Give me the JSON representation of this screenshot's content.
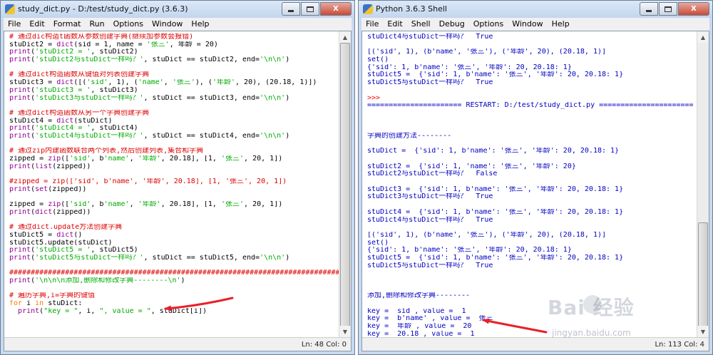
{
  "editor": {
    "title": "study_dict.py - D:/test/study_dict.py (3.6.3)",
    "menu": [
      "File",
      "Edit",
      "Format",
      "Run",
      "Options",
      "Window",
      "Help"
    ],
    "status": "Ln: 48  Col: 0",
    "code_lines": [
      [
        {
          "t": "c",
          "v": "# 通过dic构造t函数从参数创建字典(继续加参数会报错)"
        }
      ],
      [
        {
          "t": "p",
          "v": "stuDict2 = "
        },
        {
          "t": "b",
          "v": "dict"
        },
        {
          "t": "p",
          "v": "(sid = 1, name = "
        },
        {
          "t": "s",
          "v": "'张三'"
        },
        {
          "t": "p",
          "v": ", 年龄 = 20)"
        }
      ],
      [
        {
          "t": "b",
          "v": "print"
        },
        {
          "t": "p",
          "v": "("
        },
        {
          "t": "s",
          "v": "'stuDict2 = '"
        },
        {
          "t": "p",
          "v": ", stuDict2)"
        }
      ],
      [
        {
          "t": "b",
          "v": "print"
        },
        {
          "t": "p",
          "v": "("
        },
        {
          "t": "s",
          "v": "'stuDict2与stuDict一样吗？'"
        },
        {
          "t": "p",
          "v": ", stuDict == stuDict2, end="
        },
        {
          "t": "s",
          "v": "'\\n\\n'"
        },
        {
          "t": "p",
          "v": ")"
        }
      ],
      [
        {
          "t": "p",
          "v": ""
        }
      ],
      [
        {
          "t": "c",
          "v": "# 通过dict构造函数从键值对列表创建字典"
        }
      ],
      [
        {
          "t": "p",
          "v": "stuDict3 = "
        },
        {
          "t": "b",
          "v": "dict"
        },
        {
          "t": "p",
          "v": "([("
        },
        {
          "t": "s",
          "v": "'sid'"
        },
        {
          "t": "p",
          "v": ", 1), ("
        },
        {
          "t": "s",
          "v": "'name'"
        },
        {
          "t": "p",
          "v": ", "
        },
        {
          "t": "s",
          "v": "'张三'"
        },
        {
          "t": "p",
          "v": "), ("
        },
        {
          "t": "s",
          "v": "'年龄'"
        },
        {
          "t": "p",
          "v": ", 20), (20.18, 1)])"
        }
      ],
      [
        {
          "t": "b",
          "v": "print"
        },
        {
          "t": "p",
          "v": "("
        },
        {
          "t": "s",
          "v": "'stuDict3 = '"
        },
        {
          "t": "p",
          "v": ", stuDict3)"
        }
      ],
      [
        {
          "t": "b",
          "v": "print"
        },
        {
          "t": "p",
          "v": "("
        },
        {
          "t": "s",
          "v": "'stuDict3与stuDict一样吗？'"
        },
        {
          "t": "p",
          "v": ", stuDict == stuDict3, end="
        },
        {
          "t": "s",
          "v": "'\\n\\n'"
        },
        {
          "t": "p",
          "v": ")"
        }
      ],
      [
        {
          "t": "p",
          "v": ""
        }
      ],
      [
        {
          "t": "c",
          "v": "# 通过dict构造函数从另一个字典创建字典"
        }
      ],
      [
        {
          "t": "p",
          "v": "stuDict4 = "
        },
        {
          "t": "b",
          "v": "dict"
        },
        {
          "t": "p",
          "v": "(stuDict)"
        }
      ],
      [
        {
          "t": "b",
          "v": "print"
        },
        {
          "t": "p",
          "v": "("
        },
        {
          "t": "s",
          "v": "'stuDict4 = '"
        },
        {
          "t": "p",
          "v": ", stuDict4)"
        }
      ],
      [
        {
          "t": "b",
          "v": "print"
        },
        {
          "t": "p",
          "v": "("
        },
        {
          "t": "s",
          "v": "'stuDict4与stuDict一样吗？'"
        },
        {
          "t": "p",
          "v": ", stuDict == stuDict4, end="
        },
        {
          "t": "s",
          "v": "'\\n\\n'"
        },
        {
          "t": "p",
          "v": ")"
        }
      ],
      [
        {
          "t": "p",
          "v": ""
        }
      ],
      [
        {
          "t": "c",
          "v": "# 通过zip内建函数联合两个列表,然后创建列表,集合和字典"
        }
      ],
      [
        {
          "t": "p",
          "v": "zipped = "
        },
        {
          "t": "b",
          "v": "zip"
        },
        {
          "t": "p",
          "v": "(["
        },
        {
          "t": "s",
          "v": "'sid'"
        },
        {
          "t": "p",
          "v": ", b"
        },
        {
          "t": "s",
          "v": "'name'"
        },
        {
          "t": "p",
          "v": ", "
        },
        {
          "t": "s",
          "v": "'年龄'"
        },
        {
          "t": "p",
          "v": ", 20.18], [1, "
        },
        {
          "t": "s",
          "v": "'张三'"
        },
        {
          "t": "p",
          "v": ", 20, 1])"
        }
      ],
      [
        {
          "t": "b",
          "v": "print"
        },
        {
          "t": "p",
          "v": "("
        },
        {
          "t": "b",
          "v": "list"
        },
        {
          "t": "p",
          "v": "(zipped))"
        }
      ],
      [
        {
          "t": "p",
          "v": ""
        }
      ],
      [
        {
          "t": "c",
          "v": "#zipped = zip(['sid', b'name', '年龄', 20.18], [1, '张三', 20, 1])"
        }
      ],
      [
        {
          "t": "b",
          "v": "print"
        },
        {
          "t": "p",
          "v": "("
        },
        {
          "t": "b",
          "v": "set"
        },
        {
          "t": "p",
          "v": "(zipped))"
        }
      ],
      [
        {
          "t": "p",
          "v": ""
        }
      ],
      [
        {
          "t": "p",
          "v": "zipped = "
        },
        {
          "t": "b",
          "v": "zip"
        },
        {
          "t": "p",
          "v": "(["
        },
        {
          "t": "s",
          "v": "'sid'"
        },
        {
          "t": "p",
          "v": ", b"
        },
        {
          "t": "s",
          "v": "'name'"
        },
        {
          "t": "p",
          "v": ", "
        },
        {
          "t": "s",
          "v": "'年龄'"
        },
        {
          "t": "p",
          "v": ", 20.18], [1, "
        },
        {
          "t": "s",
          "v": "'张三'"
        },
        {
          "t": "p",
          "v": ", 20, 1])"
        }
      ],
      [
        {
          "t": "b",
          "v": "print"
        },
        {
          "t": "p",
          "v": "("
        },
        {
          "t": "b",
          "v": "dict"
        },
        {
          "t": "p",
          "v": "(zipped))"
        }
      ],
      [
        {
          "t": "p",
          "v": ""
        }
      ],
      [
        {
          "t": "c",
          "v": "# 通过dict.update方法创建字典"
        }
      ],
      [
        {
          "t": "p",
          "v": "stuDict5 = "
        },
        {
          "t": "b",
          "v": "dict"
        },
        {
          "t": "p",
          "v": "()"
        }
      ],
      [
        {
          "t": "p",
          "v": "stuDict5.update(stuDict)"
        }
      ],
      [
        {
          "t": "b",
          "v": "print"
        },
        {
          "t": "p",
          "v": "("
        },
        {
          "t": "s",
          "v": "'stuDict5 = '"
        },
        {
          "t": "p",
          "v": ", stuDict5)"
        }
      ],
      [
        {
          "t": "b",
          "v": "print"
        },
        {
          "t": "p",
          "v": "("
        },
        {
          "t": "s",
          "v": "'stuDict5与stuDict一样吗？'"
        },
        {
          "t": "p",
          "v": ", stuDict == stuDict5, end="
        },
        {
          "t": "s",
          "v": "'\\n\\n'"
        },
        {
          "t": "p",
          "v": ")"
        }
      ],
      [
        {
          "t": "p",
          "v": ""
        }
      ],
      [
        {
          "t": "c",
          "v": "################################################################################"
        }
      ],
      [
        {
          "t": "b",
          "v": "print"
        },
        {
          "t": "p",
          "v": "("
        },
        {
          "t": "s",
          "v": "'\\n\\n\\n添加,删除和修改字典--------\\n'"
        },
        {
          "t": "p",
          "v": ")"
        }
      ],
      [
        {
          "t": "p",
          "v": ""
        }
      ],
      [
        {
          "t": "c",
          "v": "# 遍历字典,i=字典的键值"
        }
      ],
      [
        {
          "t": "k",
          "v": "for"
        },
        {
          "t": "p",
          "v": " i "
        },
        {
          "t": "k",
          "v": "in"
        },
        {
          "t": "p",
          "v": " stuDict:"
        }
      ],
      [
        {
          "t": "p",
          "v": "  "
        },
        {
          "t": "b",
          "v": "print"
        },
        {
          "t": "p",
          "v": "("
        },
        {
          "t": "s",
          "v": "\"key = \""
        },
        {
          "t": "p",
          "v": ", i, "
        },
        {
          "t": "s",
          "v": "\", value = \""
        },
        {
          "t": "p",
          "v": ", stuDict[i])"
        }
      ]
    ]
  },
  "shell": {
    "title": "Python 3.6.3 Shell",
    "menu": [
      "File",
      "Edit",
      "Shell",
      "Debug",
      "Options",
      "Window",
      "Help"
    ],
    "status": "Ln: 113  Col: 4",
    "output_lines": [
      {
        "t": "o",
        "v": "stuDict4与stuDict一样吗？  True"
      },
      {
        "t": "o",
        "v": ""
      },
      {
        "t": "o",
        "v": "[('sid', 1), (b'name', '张三'), ('年龄', 20), (20.18, 1)]"
      },
      {
        "t": "o",
        "v": "set()"
      },
      {
        "t": "o",
        "v": "{'sid': 1, b'name': '张三', '年龄': 20, 20.18: 1}"
      },
      {
        "t": "o",
        "v": "stuDict5 =  {'sid': 1, b'name': '张三', '年龄': 20, 20.18: 1}"
      },
      {
        "t": "o",
        "v": "stuDict5与stuDict一样吗？  True"
      },
      {
        "t": "o",
        "v": ""
      },
      {
        "t": "r",
        "v": ">>>"
      },
      {
        "t": "o",
        "v": "====================== RESTART: D:/test/study_dict.py ======================"
      },
      {
        "t": "o",
        "v": ""
      },
      {
        "t": "o",
        "v": ""
      },
      {
        "t": "o",
        "v": ""
      },
      {
        "t": "o",
        "v": "字典的创建方法--------"
      },
      {
        "t": "o",
        "v": ""
      },
      {
        "t": "o",
        "v": "stuDict =  {'sid': 1, b'name': '张三', '年龄': 20, 20.18: 1}"
      },
      {
        "t": "o",
        "v": ""
      },
      {
        "t": "o",
        "v": "stuDict2 =  {'sid': 1, 'name': '张三', '年龄': 20}"
      },
      {
        "t": "o",
        "v": "stuDict2与stuDict一样吗？  False"
      },
      {
        "t": "o",
        "v": ""
      },
      {
        "t": "o",
        "v": "stuDict3 =  {'sid': 1, b'name': '张三', '年龄': 20, 20.18: 1}"
      },
      {
        "t": "o",
        "v": "stuDict3与stuDict一样吗？  True"
      },
      {
        "t": "o",
        "v": ""
      },
      {
        "t": "o",
        "v": "stuDict4 =  {'sid': 1, b'name': '张三', '年龄': 20, 20.18: 1}"
      },
      {
        "t": "o",
        "v": "stuDict4与stuDict一样吗？  True"
      },
      {
        "t": "o",
        "v": ""
      },
      {
        "t": "o",
        "v": "[('sid', 1), (b'name', '张三'), ('年龄', 20), (20.18, 1)]"
      },
      {
        "t": "o",
        "v": "set()"
      },
      {
        "t": "o",
        "v": "{'sid': 1, b'name': '张三', '年龄': 20, 20.18: 1}"
      },
      {
        "t": "o",
        "v": "stuDict5 =  {'sid': 1, b'name': '张三', '年龄': 20, 20.18: 1}"
      },
      {
        "t": "o",
        "v": "stuDict5与stuDict一样吗？  True"
      },
      {
        "t": "o",
        "v": ""
      },
      {
        "t": "o",
        "v": ""
      },
      {
        "t": "o",
        "v": ""
      },
      {
        "t": "o",
        "v": "添加,删除和修改字典--------"
      },
      {
        "t": "o",
        "v": ""
      },
      {
        "t": "o",
        "v": "key =  sid , value =  1"
      },
      {
        "t": "o",
        "v": "key =  b'name' , value =  张三"
      },
      {
        "t": "o",
        "v": "key =  年龄 , value =  20"
      },
      {
        "t": "o",
        "v": "key =  20.18 , value =  1"
      },
      {
        "t": "r",
        "v": ">>> "
      }
    ]
  },
  "window_buttons": {
    "minimize": "minimize",
    "maximize": "maximize",
    "close": "X"
  },
  "watermark": {
    "brand": "Bai  经验",
    "domain": "jingyan.baidu.com"
  },
  "colors": {
    "keyword": "#ff7700",
    "comment": "#dd0000",
    "string": "#00aa00",
    "builtin": "#900090",
    "output": "#0000c0",
    "prompt": "#ff0000",
    "annotation_arrow": "#e8202a"
  }
}
